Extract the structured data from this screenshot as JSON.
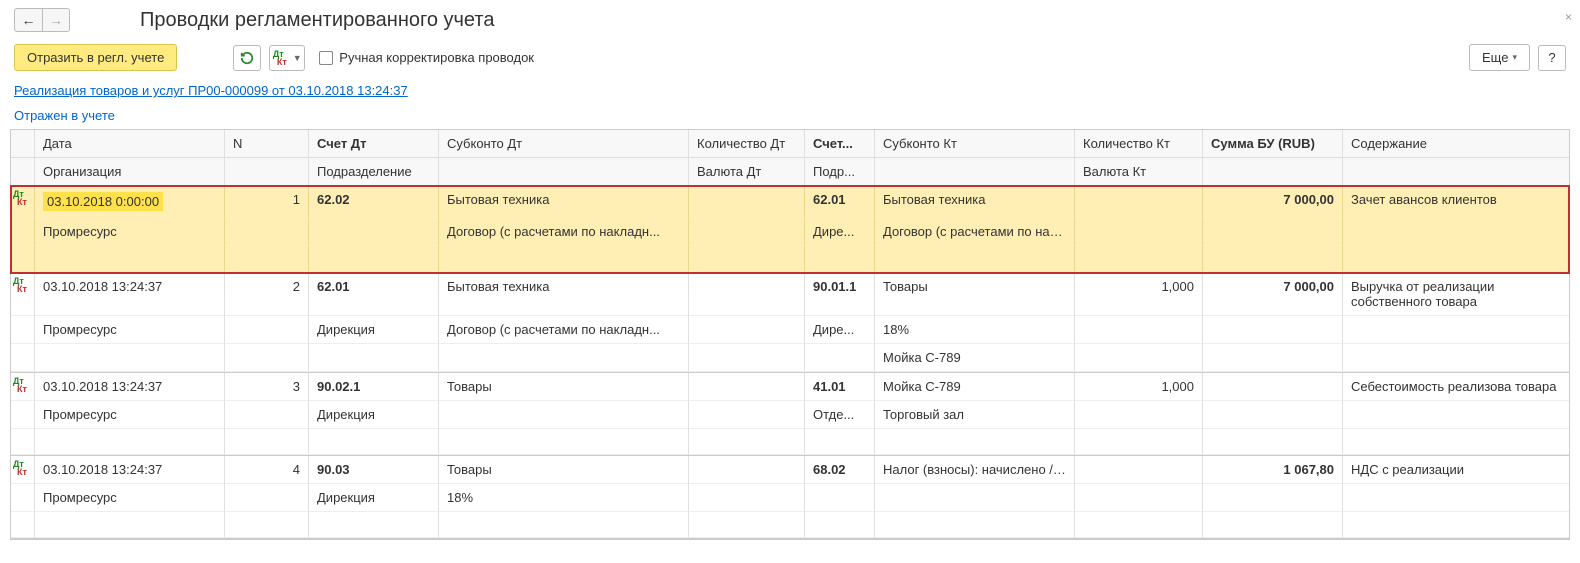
{
  "nav": {
    "back": "←",
    "forward": "→",
    "close": "×"
  },
  "title": "Проводки регламентированного учета",
  "toolbar": {
    "reflect": "Отразить в регл. учете",
    "manual_check_label": "Ручная корректировка проводок",
    "more": "Еще",
    "help": "?"
  },
  "doc_link": "Реализация товаров и услуг ПР00-000099 от 03.10.2018 13:24:37",
  "status": "Отражен в учете",
  "headers": {
    "r1": {
      "date": "Дата",
      "n": "N",
      "acct_dt": "Счет Дт",
      "sub_dt": "Субконто Дт",
      "qty_dt": "Количество Дт",
      "acct_kt": "Счет...",
      "sub_kt": "Субконто Кт",
      "qty_kt": "Количество Кт",
      "sum": "Сумма БУ (RUB)",
      "desc": "Содержание"
    },
    "r2": {
      "org": "Организация",
      "dept": "Подразделение",
      "cur_dt": "Валюта Дт",
      "dept_kt": "Подр...",
      "cur_kt": "Валюта Кт"
    }
  },
  "rows": [
    {
      "hl": true,
      "date": "03.10.2018 0:00:00",
      "n": "1",
      "acct_dt": "62.02",
      "sub_dt_1": "Бытовая техника",
      "sub_dt_2": "Договор (с расчетами по накладн...",
      "qty_dt": "",
      "acct_kt": "62.01",
      "sub_kt_1": "Бытовая техника",
      "sub_kt_2": "Договор (с расчетами по накла...",
      "qty_kt": "",
      "sum": "7 000,00",
      "desc": "Зачет авансов клиентов",
      "org": "Промресурс",
      "dept_dt": "",
      "cur_dt": "",
      "dept_kt": "Дире...",
      "cur_kt": "",
      "sub_dt_3": "",
      "sub_kt_3": ""
    },
    {
      "hl": false,
      "date": "03.10.2018 13:24:37",
      "n": "2",
      "acct_dt": "62.01",
      "sub_dt_1": "Бытовая техника",
      "sub_dt_2": "Договор (с расчетами по накладн...",
      "qty_dt": "",
      "acct_kt": "90.01.1",
      "sub_kt_1": "Товары",
      "sub_kt_2": "18%",
      "sub_kt_3": "Мойка C-789",
      "qty_kt": "1,000",
      "sum": "7 000,00",
      "desc": "Выручка от реализации собственного товара",
      "org": "Промресурс",
      "dept_dt": "Дирекция",
      "cur_dt": "",
      "dept_kt": "Дире...",
      "cur_kt": "",
      "sub_dt_3": ""
    },
    {
      "hl": false,
      "date": "03.10.2018 13:24:37",
      "n": "3",
      "acct_dt": "90.02.1",
      "sub_dt_1": "Товары",
      "sub_dt_2": "",
      "sub_dt_3": "",
      "qty_dt": "",
      "acct_kt": "41.01",
      "sub_kt_1": "Мойка C-789",
      "sub_kt_2": "Торговый зал",
      "sub_kt_3": "",
      "qty_kt": "1,000",
      "sum": "",
      "desc": "Себестоимость реализова товара",
      "org": "Промресурс",
      "dept_dt": "Дирекция",
      "cur_dt": "",
      "dept_kt": "Отде...",
      "cur_kt": ""
    },
    {
      "hl": false,
      "date": "03.10.2018 13:24:37",
      "n": "4",
      "acct_dt": "90.03",
      "sub_dt_1": "Товары",
      "sub_dt_2": "18%",
      "sub_dt_3": "",
      "qty_dt": "",
      "acct_kt": "68.02",
      "sub_kt_1": "Налог (взносы): начислено / уп...",
      "sub_kt_2": "",
      "sub_kt_3": "",
      "qty_kt": "",
      "sum": "1 067,80",
      "desc": "НДС с реализации",
      "org": "Промресурс",
      "dept_dt": "Дирекция",
      "cur_dt": "",
      "dept_kt": "",
      "cur_kt": ""
    }
  ]
}
